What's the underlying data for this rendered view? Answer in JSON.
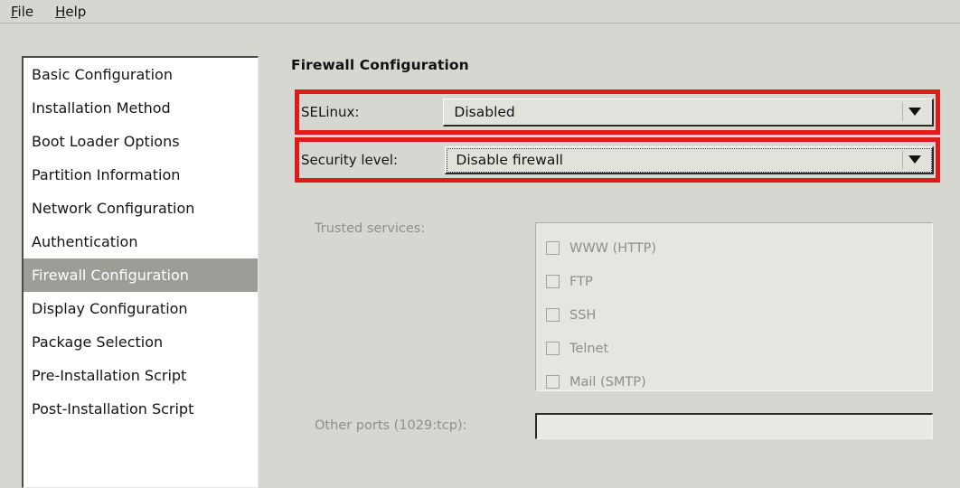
{
  "menubar": {
    "items": [
      {
        "accel": "F",
        "rest": "ile"
      },
      {
        "accel": "H",
        "rest": "elp"
      }
    ]
  },
  "sidebar": {
    "items": [
      {
        "label": "Basic Configuration",
        "selected": false
      },
      {
        "label": "Installation Method",
        "selected": false
      },
      {
        "label": "Boot Loader Options",
        "selected": false
      },
      {
        "label": "Partition Information",
        "selected": false
      },
      {
        "label": "Network Configuration",
        "selected": false
      },
      {
        "label": "Authentication",
        "selected": false
      },
      {
        "label": "Firewall Configuration",
        "selected": true
      },
      {
        "label": "Display Configuration",
        "selected": false
      },
      {
        "label": "Package Selection",
        "selected": false
      },
      {
        "label": "Pre-Installation Script",
        "selected": false
      },
      {
        "label": "Post-Installation Script",
        "selected": false
      }
    ]
  },
  "pane": {
    "title": "Firewall Configuration",
    "selinux": {
      "label": "SELinux:",
      "value": "Disabled",
      "arrow_icon": "chevron-down-icon"
    },
    "security_level": {
      "label": "Security level:",
      "value": "Disable firewall",
      "arrow_icon": "chevron-down-icon"
    },
    "trusted_services": {
      "label": "Trusted services:",
      "items": [
        {
          "label": "WWW (HTTP)",
          "checked": false
        },
        {
          "label": "FTP",
          "checked": false
        },
        {
          "label": "SSH",
          "checked": false
        },
        {
          "label": "Telnet",
          "checked": false
        },
        {
          "label": "Mail (SMTP)",
          "checked": false
        }
      ]
    },
    "other_ports": {
      "label": "Other ports (1029:tcp):",
      "value": "",
      "placeholder": ""
    }
  },
  "annotations": {
    "highlight_color": "#e01b1b",
    "boxes": [
      {
        "name": "selinux-row-highlight"
      },
      {
        "name": "security-level-row-highlight"
      }
    ]
  }
}
